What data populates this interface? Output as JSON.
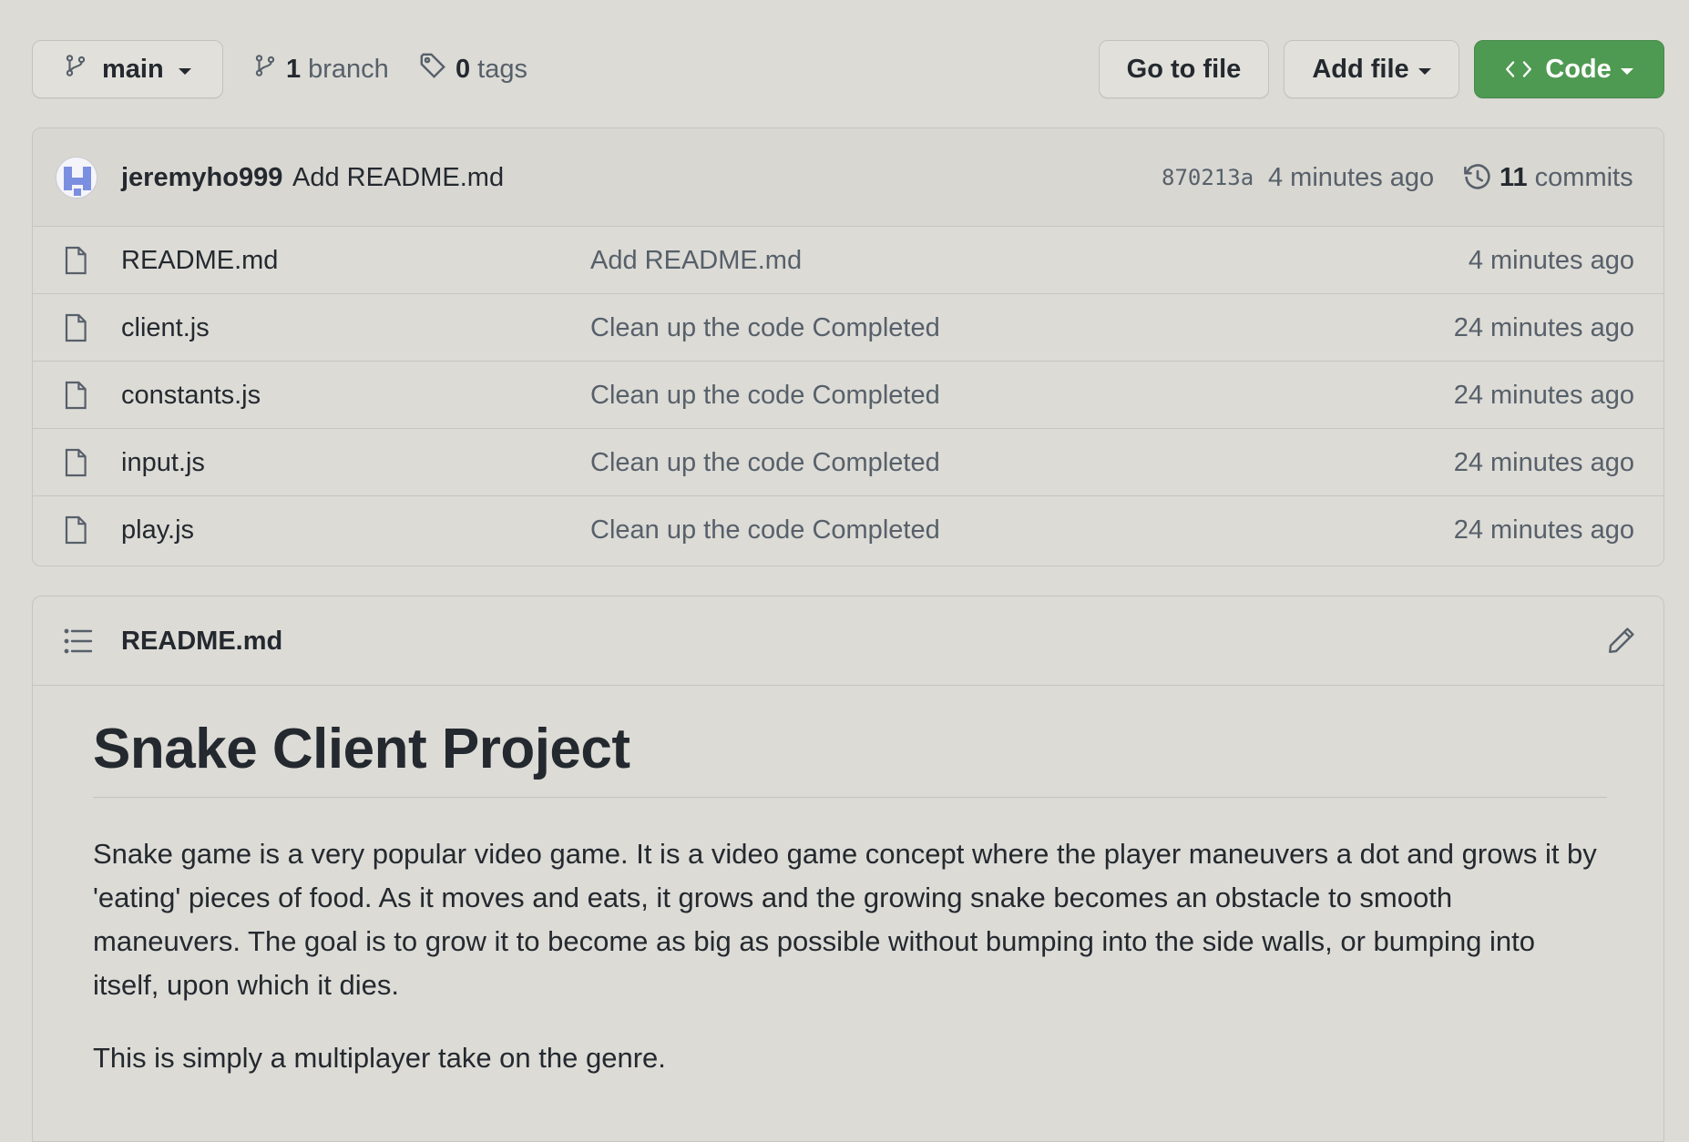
{
  "branch_selector": {
    "label": "main"
  },
  "branches": {
    "count": "1",
    "label": "branch"
  },
  "tags": {
    "count": "0",
    "label": "tags"
  },
  "actions": {
    "go_to_file": "Go to file",
    "add_file": "Add file",
    "code": "Code"
  },
  "latest_commit": {
    "author": "jeremyho999",
    "message": "Add README.md",
    "sha": "870213a",
    "time": "4 minutes ago",
    "commits_count": "11",
    "commits_label": "commits"
  },
  "files": [
    {
      "name": "README.md",
      "message": "Add README.md",
      "time": "4 minutes ago"
    },
    {
      "name": "client.js",
      "message": "Clean up the code Completed",
      "time": "24 minutes ago"
    },
    {
      "name": "constants.js",
      "message": "Clean up the code Completed",
      "time": "24 minutes ago"
    },
    {
      "name": "input.js",
      "message": "Clean up the code Completed",
      "time": "24 minutes ago"
    },
    {
      "name": "play.js",
      "message": "Clean up the code Completed",
      "time": "24 minutes ago"
    }
  ],
  "readme": {
    "filename": "README.md",
    "heading": "Snake Client Project",
    "paragraphs": [
      "Snake game is a very popular video game. It is a video game concept where the player maneuvers a dot and grows it by 'eating' pieces of food. As it moves and eats, it grows and the growing snake becomes an obstacle to smooth maneuvers. The goal is to grow it to become as big as possible without bumping into the side walls, or bumping into itself, upon which it dies.",
      "This is simply a multiplayer take on the genre."
    ]
  },
  "colors": {
    "page_background": "#dcdbd6",
    "code_button": "#4f9a52",
    "text_primary": "#24292f",
    "text_muted": "#57606a",
    "avatar_accent": "#7b8fe0"
  },
  "icons": {
    "branch": "git-branch-icon",
    "tag": "tag-icon",
    "code": "code-icon",
    "history": "history-icon",
    "file": "file-icon",
    "list": "list-unordered-icon",
    "edit": "pencil-icon"
  }
}
